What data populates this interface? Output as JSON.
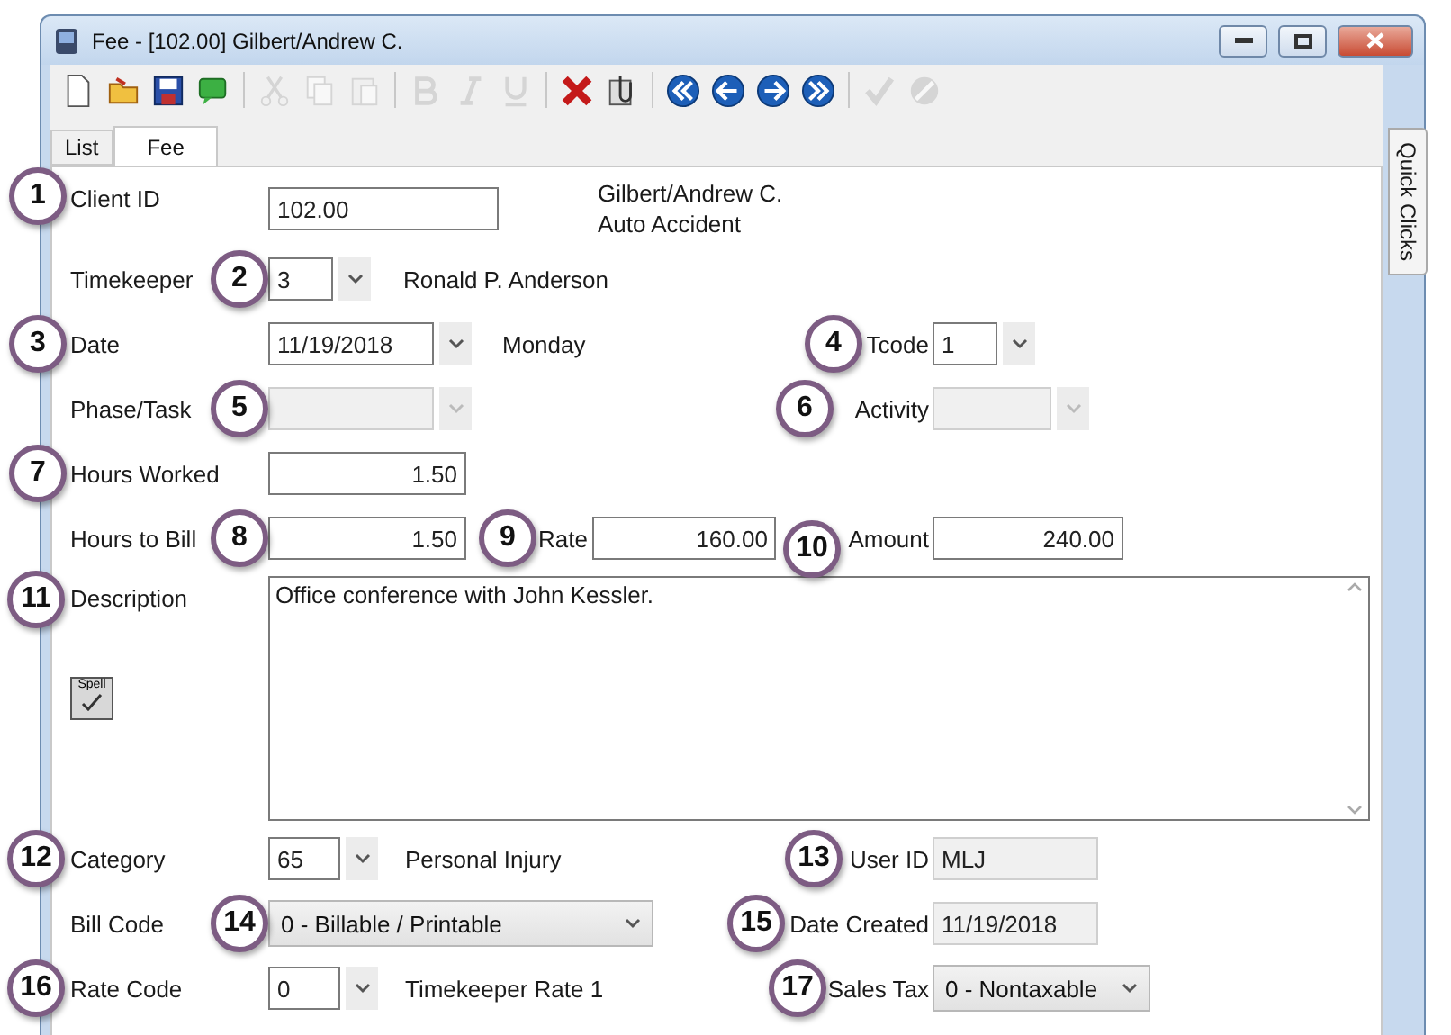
{
  "window": {
    "title": "Fee - [102.00] Gilbert/Andrew C."
  },
  "toolbar": [
    [
      {
        "kind": "new",
        "disabled": false
      },
      {
        "kind": "open",
        "disabled": false
      },
      {
        "kind": "save",
        "disabled": false
      },
      {
        "kind": "note",
        "disabled": false
      }
    ],
    [
      {
        "kind": "cut",
        "disabled": true
      },
      {
        "kind": "copy",
        "disabled": true
      },
      {
        "kind": "paste",
        "disabled": true
      }
    ],
    [
      {
        "kind": "bold",
        "disabled": true
      },
      {
        "kind": "italic",
        "disabled": true
      },
      {
        "kind": "underline",
        "disabled": true
      }
    ],
    [
      {
        "kind": "delete",
        "disabled": false
      },
      {
        "kind": "attach",
        "disabled": false
      }
    ],
    [
      {
        "kind": "first",
        "disabled": false
      },
      {
        "kind": "previous",
        "disabled": false
      },
      {
        "kind": "next",
        "disabled": false
      },
      {
        "kind": "last",
        "disabled": false
      }
    ],
    [
      {
        "kind": "accept",
        "disabled": true
      },
      {
        "kind": "cancel",
        "disabled": true
      }
    ]
  ],
  "tabs": [
    {
      "label": "List",
      "selected": false
    },
    {
      "label": "Fee",
      "selected": true
    }
  ],
  "side_tab": {
    "label": "Quick Clicks"
  },
  "form": {
    "client_id": {
      "callout": "1",
      "label": "Client ID",
      "value": "102.00",
      "client_name": "Gilbert/Andrew C.",
      "matter": "Auto Accident"
    },
    "timekeeper": {
      "callout": "2",
      "label": "Timekeeper",
      "value": "3",
      "name": "Ronald P. Anderson"
    },
    "date": {
      "callout": "3",
      "label": "Date",
      "value": "11/19/2018",
      "weekday": "Monday"
    },
    "tcode": {
      "callout": "4",
      "label": "Tcode",
      "value": "1"
    },
    "phase_task": {
      "callout": "5",
      "label": "Phase/Task",
      "disabled": true
    },
    "activity": {
      "callout": "6",
      "label": "Activity",
      "disabled": true
    },
    "hours_worked": {
      "callout": "7",
      "label": "Hours Worked",
      "value": "1.50"
    },
    "hours_to_bill": {
      "callout": "8",
      "label": "Hours to Bill",
      "value": "1.50"
    },
    "rate": {
      "callout": "9",
      "label": "Rate",
      "value": "160.00"
    },
    "amount": {
      "callout": "10",
      "label": "Amount",
      "value": "240.00"
    },
    "description": {
      "callout": "11",
      "label": "Description",
      "value": "Office conference with John Kessler.",
      "spell_button": "Spell"
    },
    "category": {
      "callout": "12",
      "label": "Category",
      "value": "65",
      "name": "Personal Injury"
    },
    "user_id": {
      "callout": "13",
      "label": "User ID",
      "value": "MLJ",
      "read_only": true
    },
    "bill_code": {
      "callout": "14",
      "label": "Bill Code",
      "value": "0 - Billable / Printable"
    },
    "date_created": {
      "callout": "15",
      "label": "Date Created",
      "value": "11/19/2018",
      "read_only": true
    },
    "rate_code": {
      "callout": "16",
      "label": "Rate Code",
      "value": "0",
      "name": "Timekeeper Rate 1"
    },
    "sales_tax": {
      "callout": "17",
      "label": "Sales Tax",
      "value": "0 - Nontaxable"
    }
  }
}
